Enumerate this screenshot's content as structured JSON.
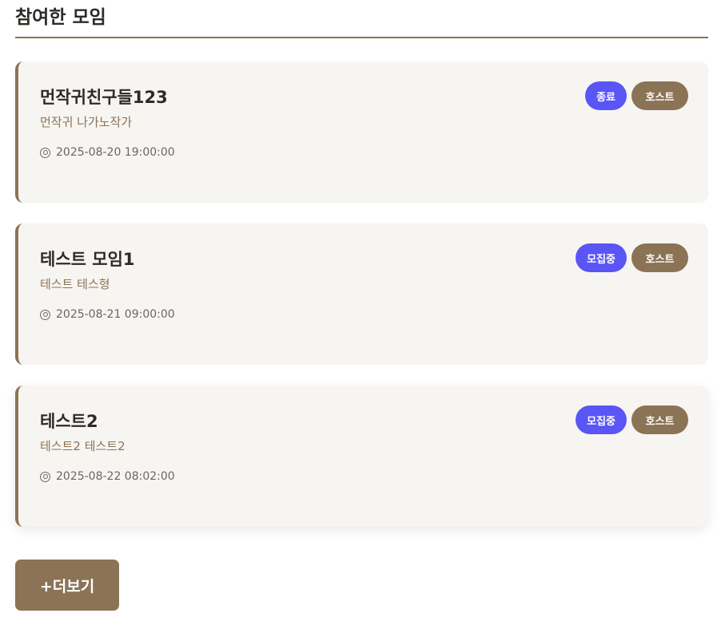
{
  "section": {
    "title": "참여한 모임"
  },
  "meetings": [
    {
      "title": "먼작귀친구들123",
      "description": "먼작귀 나가노작가",
      "datetime": "2025-08-20 19:00:00",
      "status": "종료",
      "role": "호스트"
    },
    {
      "title": "테스트 모임1",
      "description": "테스트 테스형",
      "datetime": "2025-08-21 09:00:00",
      "status": "모집중",
      "role": "호스트"
    },
    {
      "title": "테스트2",
      "description": "테스트2 테스트2",
      "datetime": "2025-08-22 08:02:00",
      "status": "모집중",
      "role": "호스트"
    }
  ],
  "more_button": {
    "label": "+더보기"
  },
  "icons": {
    "datetime": "clock-icon"
  },
  "colors": {
    "accent_brown": "#8b7355",
    "status_purple": "#5a55f5",
    "card_background": "#f7f5f2"
  }
}
